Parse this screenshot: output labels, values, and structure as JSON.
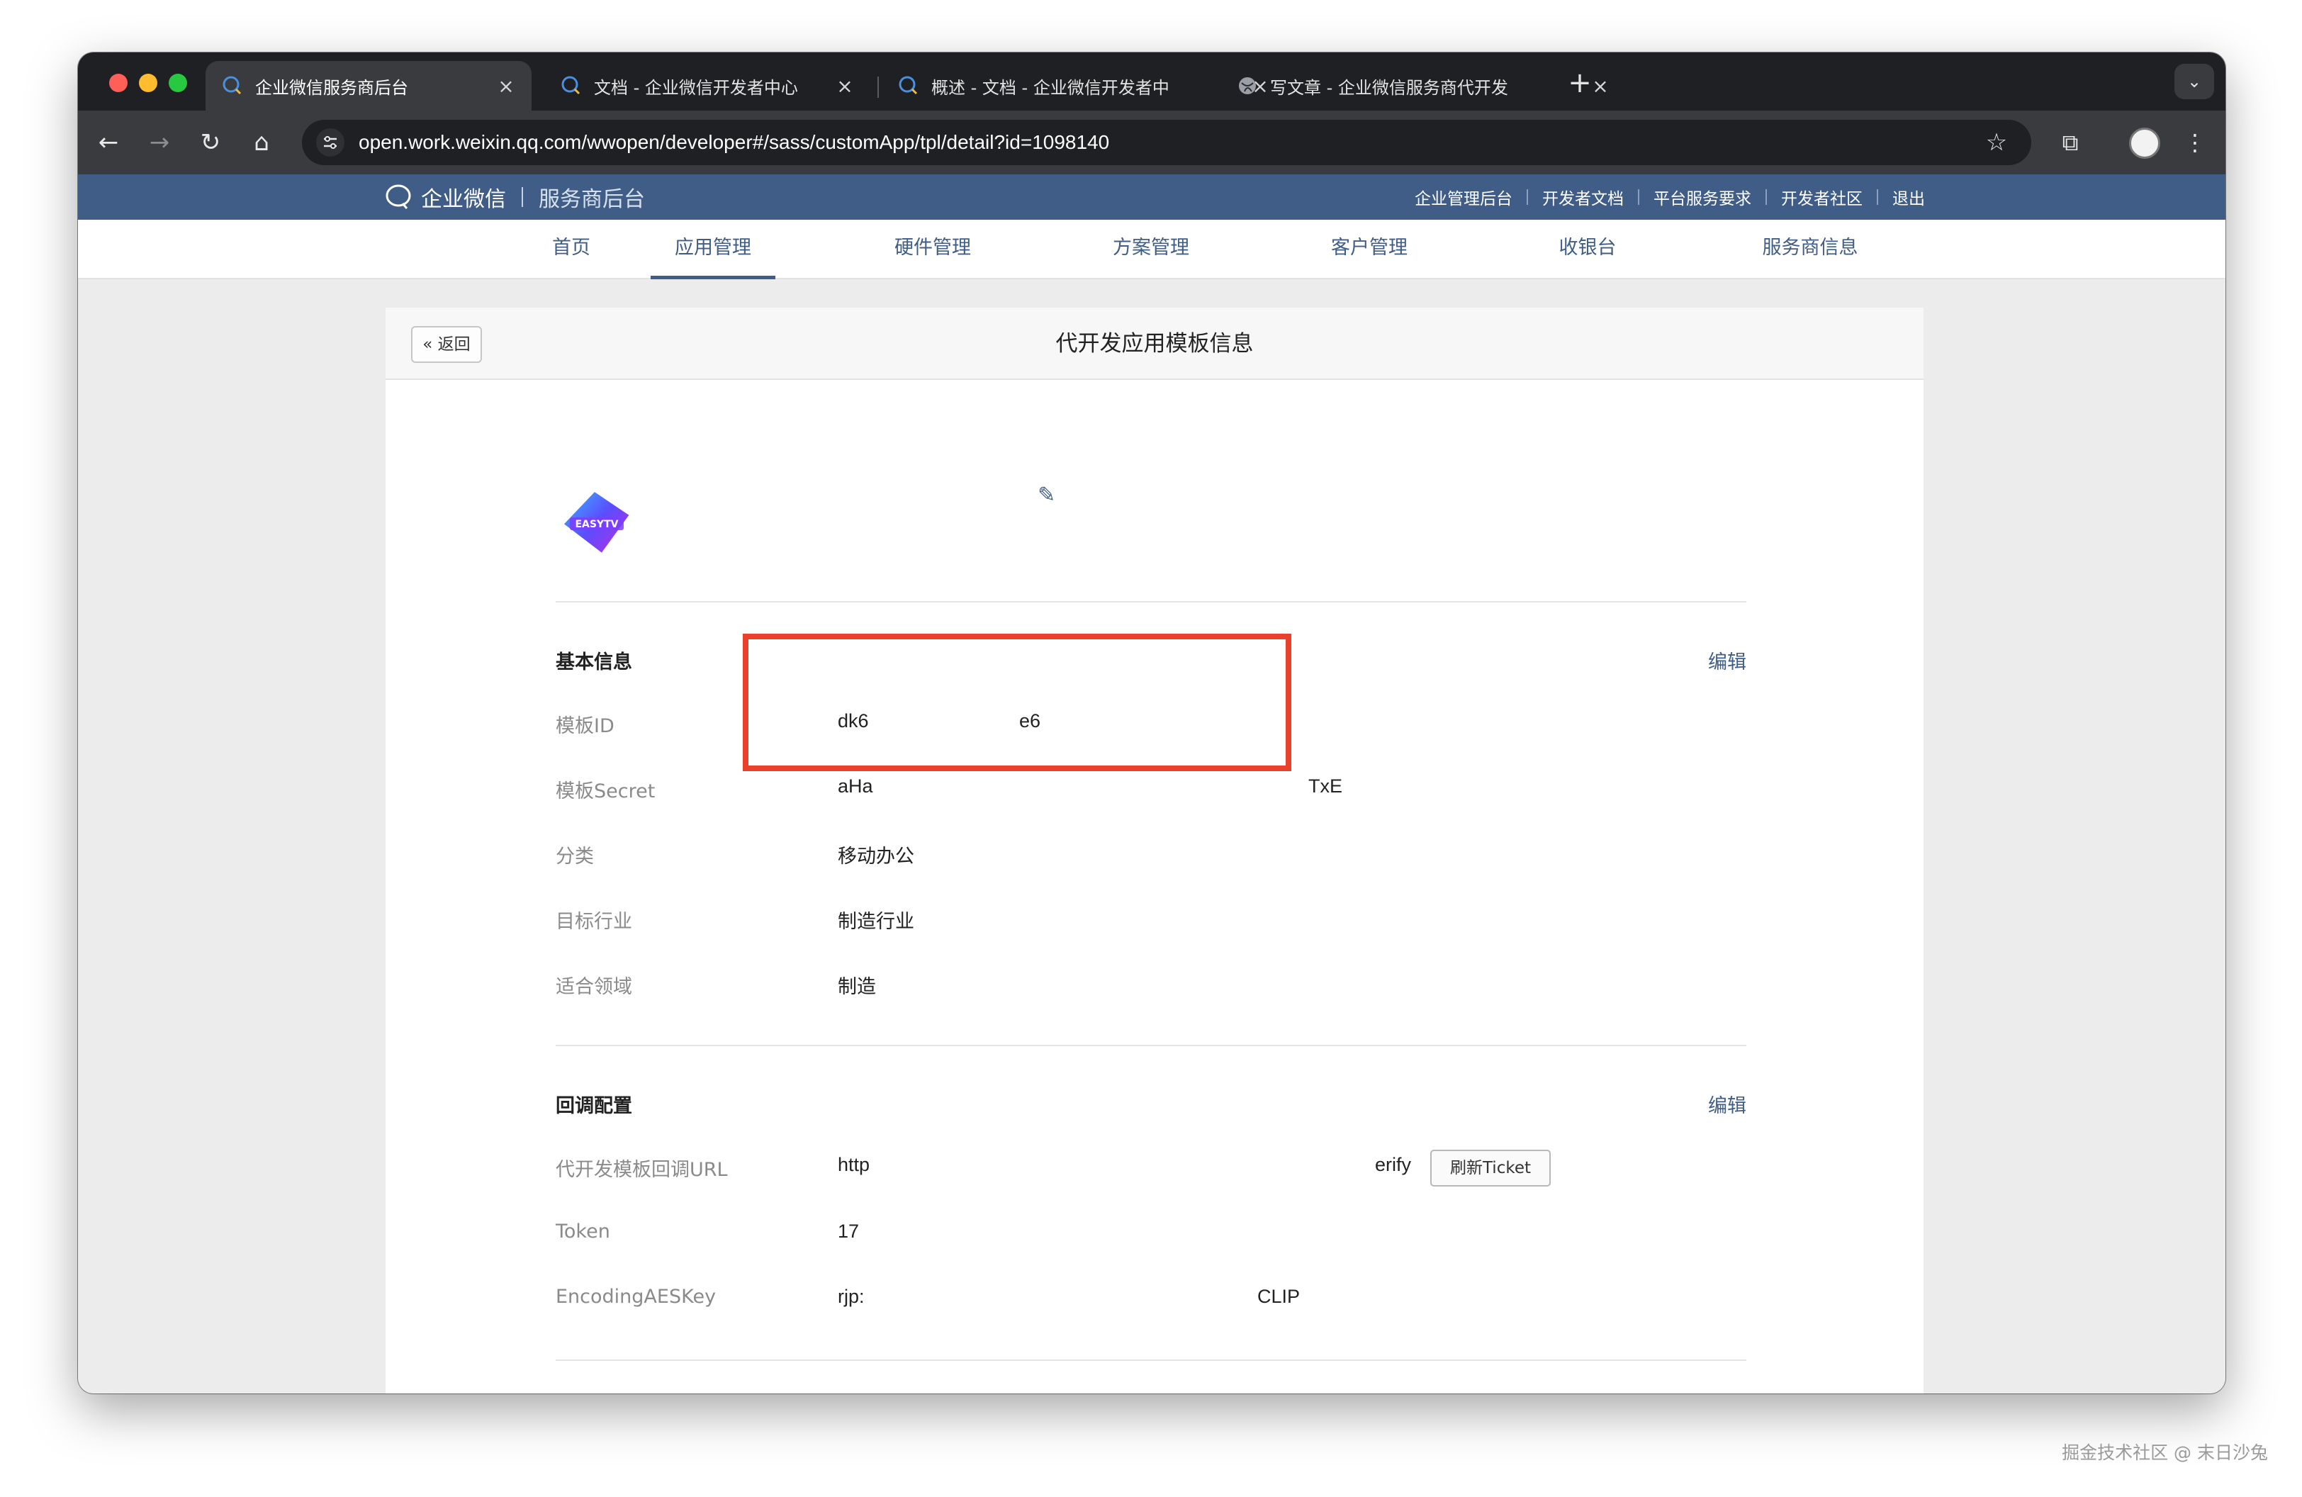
{
  "browser": {
    "tabs": [
      {
        "title": "企业微信服务商后台",
        "active": true,
        "icon": "wecom-icon"
      },
      {
        "title": "文档 - 企业微信开发者中心",
        "active": false,
        "icon": "wecom-icon"
      },
      {
        "title": "概述 - 文档 - 企业微信开发者中",
        "active": false,
        "icon": "wecom-icon"
      },
      {
        "title": "写文章 - 企业微信服务商代开发",
        "active": false,
        "icon": "globe-icon"
      }
    ],
    "tab_close_symbol": "×",
    "new_tab_symbol": "+",
    "url": "open.work.weixin.qq.com/wwopen/developer#/sass/customApp/tpl/detail?id=1098140"
  },
  "site": {
    "brand_name": "企业微信",
    "brand_sub": "服务商后台",
    "top_links": [
      "企业管理后台",
      "开发者文档",
      "平台服务要求",
      "开发者社区",
      "退出"
    ],
    "nav": [
      "首页",
      "应用管理",
      "硬件管理",
      "方案管理",
      "客户管理",
      "收银台",
      "服务商信息"
    ],
    "nav_active": "应用管理"
  },
  "panel": {
    "back_label": "« 返回",
    "title": "代开发应用模板信息",
    "app_logo_text": "EASYTV"
  },
  "basic": {
    "title": "基本信息",
    "edit": "编辑",
    "template_id_label": "模板ID",
    "template_id_value_start": "dk6",
    "template_id_value_end": "e6",
    "secret_label": "模板Secret",
    "secret_value_start": "aHa",
    "secret_value_end": "TxE",
    "category_label": "分类",
    "category_value": "移动办公",
    "industry_label": "目标行业",
    "industry_value": "制造行业",
    "domain_label": "适合领域",
    "domain_value": "制造"
  },
  "callback": {
    "title": "回调配置",
    "edit": "编辑",
    "url_label": "代开发模板回调URL",
    "url_value_start": "http",
    "url_value_end": "erify",
    "refresh_button": "刷新Ticket",
    "token_label": "Token",
    "token_value": "17",
    "aes_label": "EncodingAESKey",
    "aes_value_start": "rjp:",
    "aes_value_end": "CLIP"
  },
  "highlight_color": "#e8412c",
  "accent_color": "#3f5d86",
  "watermark": "掘金技术社区 @ 末日沙兔"
}
